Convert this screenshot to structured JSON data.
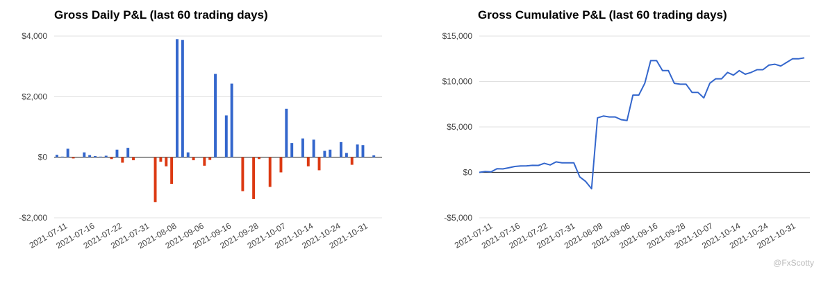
{
  "chart_data": [
    {
      "type": "bar",
      "title": "Gross Daily P&L (last 60 trading days)",
      "ylim": [
        -2000,
        4000
      ],
      "yticks": [
        -2000,
        0,
        2000,
        4000
      ],
      "ytick_labels": [
        "-$2,000",
        "$0",
        "$2,000",
        "$4,000"
      ],
      "xtick_labels": [
        "2021-07-11",
        "2021-07-16",
        "2021-07-22",
        "2021-07-31",
        "2021-08-08",
        "2021-09-06",
        "2021-09-16",
        "2021-09-28",
        "2021-10-07",
        "2021-10-14",
        "2021-10-24",
        "2021-10-31"
      ],
      "grid": true,
      "colors": {
        "positive": "#3366cc",
        "negative": "#dc3912",
        "grid": "#e0e0e0",
        "zero": "#333333"
      },
      "values": [
        80,
        20,
        280,
        -40,
        0,
        160,
        70,
        40,
        20,
        50,
        -60,
        250,
        -180,
        310,
        -100,
        0,
        0,
        0,
        -1480,
        -150,
        -300,
        -880,
        3900,
        3870,
        160,
        -100,
        0,
        -280,
        -90,
        2750,
        0,
        1380,
        2430,
        0,
        -1120,
        0,
        -1380,
        -60,
        0,
        -980,
        0,
        -500,
        1600,
        470,
        0,
        620,
        -300,
        580,
        -430,
        210,
        250,
        0,
        500,
        140,
        -250,
        420,
        400,
        0,
        60,
        0
      ]
    },
    {
      "type": "line",
      "title": "Gross Cumulative P&L (last 60 trading days)",
      "ylim": [
        -5000,
        15000
      ],
      "yticks": [
        -5000,
        0,
        5000,
        10000,
        15000
      ],
      "ytick_labels": [
        "-$5,000",
        "$0",
        "$5,000",
        "$10,000",
        "$15,000"
      ],
      "xtick_labels": [
        "2021-07-11",
        "2021-07-16",
        "2021-07-22",
        "2021-07-31",
        "2021-08-08",
        "2021-09-06",
        "2021-09-16",
        "2021-09-28",
        "2021-10-07",
        "2021-10-14",
        "2021-10-24",
        "2021-10-31"
      ],
      "grid": true,
      "colors": {
        "line": "#3366cc",
        "grid": "#e0e0e0",
        "zero": "#333333"
      },
      "values": [
        0,
        100,
        50,
        400,
        380,
        500,
        650,
        700,
        720,
        770,
        760,
        1000,
        820,
        1150,
        1050,
        1050,
        1050,
        -500,
        -1000,
        -1800,
        6000,
        6200,
        6100,
        6100,
        5800,
        5700,
        8500,
        8500,
        9800,
        12300,
        12300,
        11200,
        11200,
        9800,
        9700,
        9700,
        8800,
        8800,
        8200,
        9800,
        10300,
        10300,
        11000,
        10700,
        11200,
        10800,
        11000,
        11300,
        11300,
        11800,
        11900,
        11700,
        12100,
        12500,
        12500,
        12600
      ]
    }
  ],
  "watermark": "@FxScotty"
}
